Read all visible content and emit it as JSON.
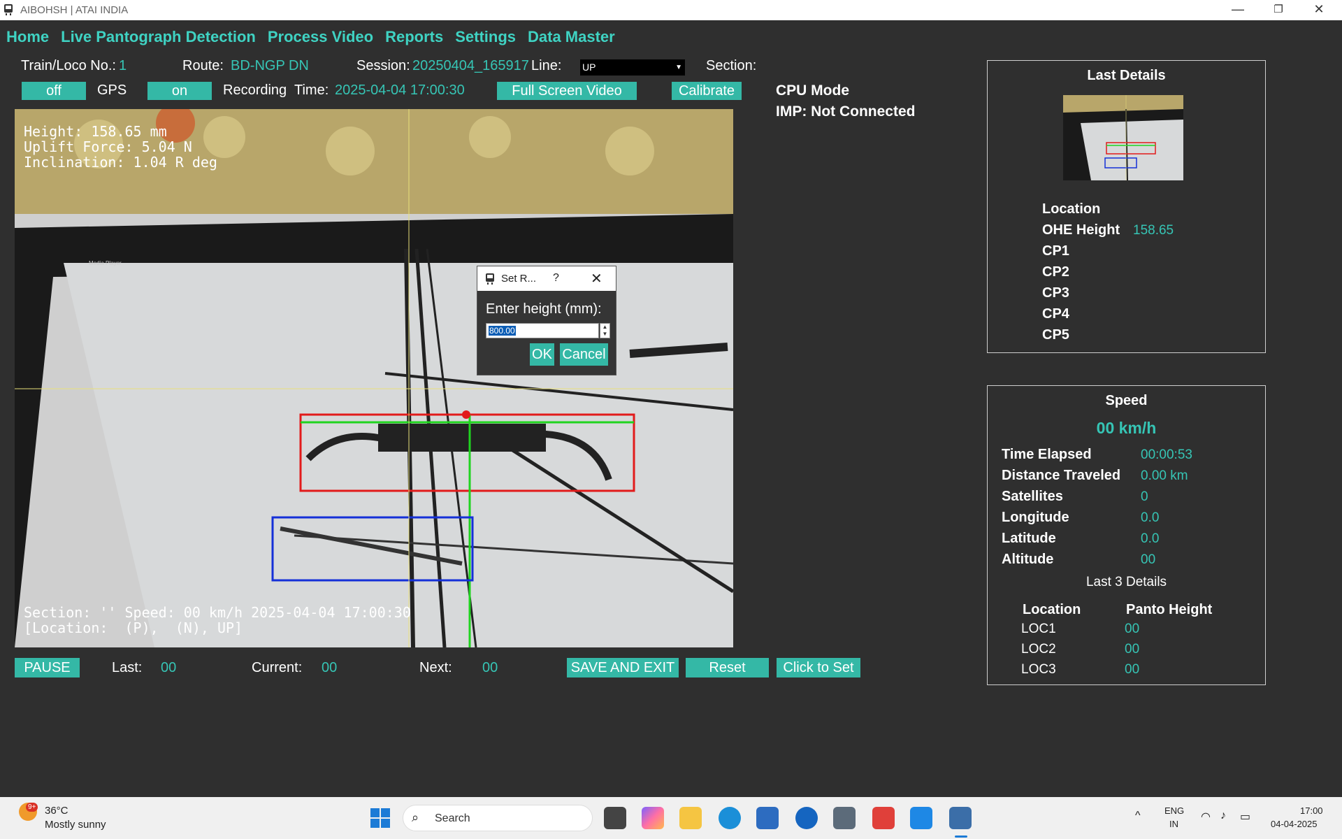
{
  "window": {
    "title": "AIBOHSH | ATAI INDIA",
    "minimize": "—",
    "maximize": "❐",
    "close": "✕"
  },
  "menu": [
    "Home",
    "Live Pantograph Detection",
    "Process Video",
    "Reports",
    "Settings",
    "Data Master"
  ],
  "info": {
    "train_label": "Train/Loco No.:",
    "train_value": "1",
    "route_label": "Route:",
    "route_value": "BD-NGP DN",
    "session_label": "Session:",
    "session_value": "20250404_165917",
    "line_label": "Line:",
    "line_value": "UP",
    "section_label": "Section:"
  },
  "toolbar": {
    "gps_toggle": "off",
    "gps_label": "GPS",
    "rec_toggle": "on",
    "rec_label": "Recording",
    "time_label": "Time:",
    "time_value": "2025-04-04 17:00:30",
    "fullscreen": "Full Screen Video",
    "calibrate": "Calibrate"
  },
  "status": {
    "cpu_mode": "CPU Mode",
    "imp": "IMP: Not Connected"
  },
  "video_overlay": {
    "height": "Height: 158.65 mm",
    "uplift": "Uplift Force: 5.04 N",
    "inclination": "Inclination: 1.04 R deg",
    "section_line": "Section: '' Speed: 00 km/h 2025-04-04 17:00:30",
    "location_line": "[Location:  (P),  (N), UP]",
    "screen_label": "Media Player"
  },
  "dialog": {
    "title": "Set R...",
    "help": "?",
    "close": "✕",
    "label": "Enter height (mm):",
    "value": "800.00",
    "ok": "OK",
    "cancel": "Cancel"
  },
  "bottom": {
    "pause": "PAUSE",
    "last_label": "Last:",
    "last_value": "00",
    "current_label": "Current:",
    "current_value": "00",
    "next_label": "Next:",
    "next_value": "00",
    "save_exit": "SAVE AND EXIT",
    "reset": "Reset",
    "click_to_set": "Click to Set"
  },
  "last_details": {
    "title": "Last Details",
    "location_label": "Location",
    "ohe_label": "OHE Height",
    "ohe_value": "158.65",
    "cp1": "CP1",
    "cp2": "CP2",
    "cp3": "CP3",
    "cp4": "CP4",
    "cp5": "CP5"
  },
  "speed_panel": {
    "title": "Speed",
    "speed_value": "00 km/h",
    "time_elapsed_label": "Time Elapsed",
    "time_elapsed_value": "00:00:53",
    "distance_label": "Distance Traveled",
    "distance_value": "0.00 km",
    "satellites_label": "Satellites",
    "satellites_value": "0",
    "longitude_label": "Longitude",
    "longitude_value": "0.0",
    "latitude_label": "Latitude",
    "latitude_value": "0.0",
    "altitude_label": "Altitude",
    "altitude_value": "00",
    "last3_title": "Last 3 Details",
    "col_location": "Location",
    "col_panto": "Panto Height",
    "rows": [
      {
        "loc": "LOC1",
        "height": "00"
      },
      {
        "loc": "LOC2",
        "height": "00"
      },
      {
        "loc": "LOC3",
        "height": "00"
      }
    ]
  },
  "taskbar": {
    "weather_badge": "9+",
    "temperature": "36°C",
    "weather": "Mostly sunny",
    "search": "Search",
    "lang1": "ENG",
    "lang2": "IN",
    "time": "17:00",
    "date": "04-04-2025",
    "chevron": "^"
  },
  "colors": {
    "accent": "#34b8a6",
    "value_text": "#36c5b5",
    "background": "#2f2f2f"
  }
}
